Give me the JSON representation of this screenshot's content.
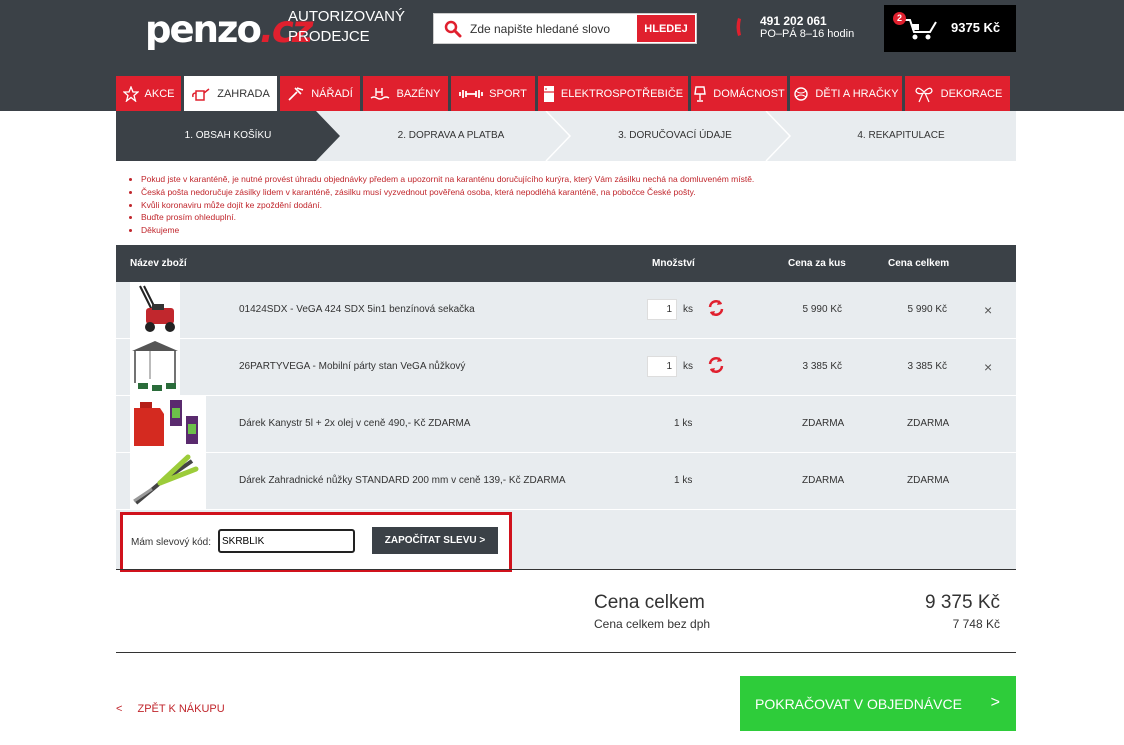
{
  "header": {
    "logo_main": "penzo",
    "logo_tld": ".cz",
    "tagline_line1": "AUTORIZOVANÝ",
    "tagline_line2": "PRODEJCE",
    "search_placeholder": "Zde napište hledané slovo",
    "search_button": "HLEDEJ",
    "phone_number": "491 202 061",
    "phone_hours": "PO–PÁ 8–16 hodin",
    "cart_count": "2",
    "cart_total": "9375 Kč"
  },
  "nav": {
    "items": [
      {
        "label": "AKCE"
      },
      {
        "label": "ZAHRADA"
      },
      {
        "label": "NÁŘADÍ"
      },
      {
        "label": "BAZÉNY"
      },
      {
        "label": "SPORT"
      },
      {
        "label": "ELEKTROSPOTŘEBIČE"
      },
      {
        "label": "DOMÁCNOST"
      },
      {
        "label": "DĚTI A HRAČKY"
      },
      {
        "label": "DEKORACE"
      }
    ]
  },
  "steps": [
    {
      "label": "1. OBSAH KOŠÍKU"
    },
    {
      "label": "2. DOPRAVA A PLATBA"
    },
    {
      "label": "3. DORUČOVACÍ ÚDAJE"
    },
    {
      "label": "4. REKAPITULACE"
    }
  ],
  "notice": [
    "Pokud jste v karanténě, je nutné provést úhradu objednávky předem a upozornit na karanténu doručujícího kurýra, který Vám zásilku nechá na domluveném místě.",
    "Česká pošta nedoručuje zásilky lidem v karanténě, zásilku musí vyzvednout pověřená osoba, která nepodléhá karanténě, na pobočce České pošty.",
    "Kvůli koronaviru může dojít ke zpoždění dodání.",
    "Buďte prosím ohleduplní.",
    "Děkujeme"
  ],
  "table": {
    "col_name": "Název zboží",
    "col_qty": "Množství",
    "col_unit_price": "Cena za kus",
    "col_total": "Cena celkem",
    "rows": [
      {
        "name": "01424SDX - VeGA 424 SDX 5in1 benzínová sekačka",
        "qty": "1",
        "unit": "ks",
        "unit_price": "5 990 Kč",
        "total": "5 990 Kč",
        "remove": "×"
      },
      {
        "name": "26PARTYVEGA - Mobilní párty stan VeGA nůžkový",
        "qty": "1",
        "unit": "ks",
        "unit_price": "3 385 Kč",
        "total": "3 385 Kč",
        "remove": "×"
      },
      {
        "name": "Dárek Kanystr 5l + 2x olej v ceně 490,- Kč ZDARMA",
        "qty": "1 ks",
        "unit_price": "ZDARMA",
        "total": "ZDARMA"
      },
      {
        "name": "Dárek Zahradnické nůžky STANDARD 200 mm v ceně 139,- Kč ZDARMA",
        "qty": "1 ks",
        "unit_price": "ZDARMA",
        "total": "ZDARMA"
      }
    ]
  },
  "coupon": {
    "label": "Mám slevový kód:",
    "value": "SKRBLÍK",
    "button": "ZAPOČÍTAT SLEVU >"
  },
  "totals": {
    "total_label": "Cena celkem",
    "total_value": "9 375 Kč",
    "net_label": "Cena celkem bez dph",
    "net_value": "7 748 Kč"
  },
  "footer": {
    "back_chevron": "<",
    "back_label": "ZPĚT K NÁKUPU",
    "continue_label": "POKRAČOVAT V OBJEDNÁVCE",
    "continue_chevron": ">"
  },
  "colors": {
    "header_bg": "#3b4147",
    "accent_red": "#e0202e",
    "continue_green": "#2ecc3a",
    "row_bg": "#e8ecef"
  }
}
